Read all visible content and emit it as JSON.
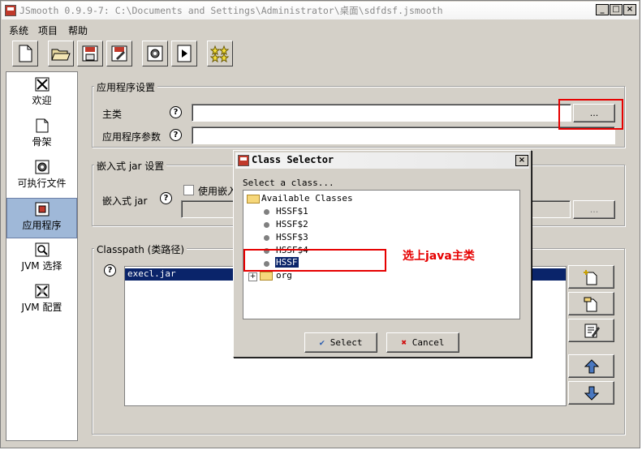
{
  "window": {
    "title": "JSmooth 0.9.9-7: C:\\Documents and Settings\\Administrator\\桌面\\sdfdsf.jsmooth",
    "buttons": [
      "_",
      "□",
      "×"
    ]
  },
  "menu": [
    "系统",
    "项目",
    "帮助"
  ],
  "toolbar": [
    "new-file-icon",
    "open-folder-icon",
    "save-icon",
    "save-as-icon",
    "compile-gear-icon",
    "run-icon",
    "stars-icon"
  ],
  "sidebar": {
    "items": [
      {
        "label": "欢迎",
        "icon": "welcome-icon"
      },
      {
        "label": "骨架",
        "icon": "skeleton-icon"
      },
      {
        "label": "可执行文件",
        "icon": "executable-gear-icon"
      },
      {
        "label": "应用程序",
        "icon": "application-icon"
      },
      {
        "label": "JVM 选择",
        "icon": "magnifier-icon"
      },
      {
        "label": "JVM 配置",
        "icon": "jvm-config-icon"
      }
    ],
    "selected": "应用程序"
  },
  "app_settings": {
    "title": "应用程序设置",
    "main_class_label": "主类",
    "args_label": "应用程序参数",
    "browse_label": "..."
  },
  "embedded_jar": {
    "title": "嵌入式 jar 设置",
    "jar_label": "嵌入式 jar",
    "use_embedded_label": "使用嵌入",
    "browse_label": "..."
  },
  "classpath": {
    "title": "Classpath (类路径)",
    "items": [
      "execl.jar"
    ]
  },
  "dialog": {
    "title": "Class Selector",
    "prompt": "Select a class...",
    "root": "Available Classes",
    "classes": [
      "HSSF$1",
      "HSSF$2",
      "HSSF$3",
      "HSSF$4",
      "HSSF"
    ],
    "packages": [
      "org"
    ],
    "select_label": "Select",
    "cancel_label": "Cancel"
  },
  "annotation": {
    "text": "选上java主类",
    "color": "#e60000"
  },
  "colors": {
    "selection": "#0a246a",
    "sidebar_selected": "#9fb8d8",
    "face": "#d4d0c8"
  }
}
